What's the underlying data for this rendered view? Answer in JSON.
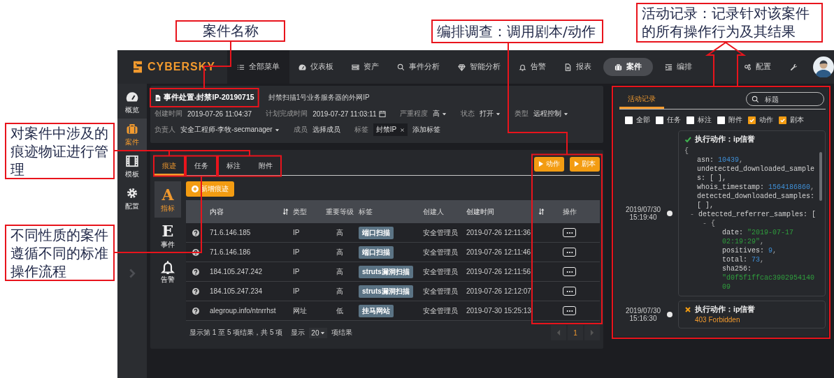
{
  "annotations": [
    {
      "text": "案件名称"
    },
    {
      "text": "编排调查：调用剧本/动作"
    },
    {
      "text": "活动记录：记录针对该案件的所有操作行为及其结果"
    },
    {
      "text": "对案件中涉及的痕迹物证进行管理"
    },
    {
      "text": "不同性质的案件遵循不同的标准操作流程"
    }
  ],
  "logo": "CYBERSKY",
  "nav": {
    "items": [
      {
        "label": "全部菜单",
        "kind": "menu",
        "selected": false
      },
      {
        "label": "仪表板",
        "kind": "page",
        "selected": false
      },
      {
        "label": "资产",
        "kind": "page",
        "selected": false
      },
      {
        "label": "事件分析",
        "kind": "page",
        "selected": false
      },
      {
        "label": "智能分析",
        "kind": "page",
        "selected": false
      },
      {
        "label": "告警",
        "kind": "page",
        "selected": false
      },
      {
        "label": "报表",
        "kind": "page",
        "selected": false
      },
      {
        "label": "案件",
        "kind": "page",
        "selected": true
      },
      {
        "label": "编排",
        "kind": "page",
        "selected": false
      }
    ],
    "settings": "配置"
  },
  "sidebar": {
    "items": [
      {
        "label": "概览",
        "selected": false
      },
      {
        "label": "案件",
        "selected": true
      },
      {
        "label": "模板",
        "selected": false
      },
      {
        "label": "配置",
        "selected": false
      }
    ]
  },
  "case": {
    "title": "事件处置-封禁IP-20190715",
    "description": "封禁扫描1号业务服务器的外网IP",
    "fields": [
      {
        "label": "创建时间",
        "value": "2019-07-26 11:04:37",
        "kind": "text"
      },
      {
        "label": "计划完成时间",
        "value": "2019-07-27 11:03:11",
        "kind": "date"
      },
      {
        "label": "严重程度",
        "value": "高",
        "kind": "select"
      },
      {
        "label": "状态",
        "value": "打开",
        "kind": "select"
      },
      {
        "label": "类型",
        "value": "远程控制",
        "kind": "select"
      }
    ],
    "fields_2": [
      {
        "label": "负责人",
        "value": "安全工程师-李牧-secmanager",
        "kind": "select"
      },
      {
        "label": "成员",
        "value": "选择成员",
        "kind": "text"
      }
    ],
    "tags": {
      "label": "标签",
      "items": [
        "封禁IP"
      ],
      "add": "添加标签"
    }
  },
  "tabs": {
    "items": [
      {
        "label": "痕迹",
        "selected": true
      },
      {
        "label": "任务",
        "selected": false
      },
      {
        "label": "标注",
        "selected": false
      },
      {
        "label": "附件",
        "selected": false
      }
    ],
    "buttons": [
      "动作",
      "剧本"
    ]
  },
  "evidence": {
    "categories": [
      {
        "kind": "glyph",
        "glyph": "A",
        "label": "指标",
        "selected": true
      },
      {
        "kind": "glyph",
        "glyph": "E",
        "label": "事件",
        "selected": false
      },
      {
        "kind": "icon",
        "label": "告警",
        "selected": false
      }
    ],
    "add_button": "新增痕迹",
    "columns": [
      {
        "label": "内容",
        "sortable": true
      },
      {
        "label": "类型",
        "sortable": false
      },
      {
        "label": "重要等级",
        "sortable": false
      },
      {
        "label": "标签",
        "sortable": false
      },
      {
        "label": "创建人",
        "sortable": false
      },
      {
        "label": "创建时间",
        "sortable": true
      },
      {
        "label": "操作",
        "sortable": false
      }
    ],
    "rows": [
      {
        "content": "71.6.146.185",
        "type": "IP",
        "level": "高",
        "tag": "端口扫描",
        "creator": "安全管理员",
        "time": "2019-07-26 12:11:36"
      },
      {
        "content": "71.6.146.186",
        "type": "IP",
        "level": "高",
        "tag": "端口扫描",
        "creator": "安全管理员",
        "time": "2019-07-26 12:11:46"
      },
      {
        "content": "184.105.247.242",
        "type": "IP",
        "level": "高",
        "tag": "struts漏洞扫描",
        "creator": "安全管理员",
        "time": "2019-07-26 12:11:56"
      },
      {
        "content": "184.105.247.234",
        "type": "IP",
        "level": "高",
        "tag": "struts漏洞扫描",
        "creator": "安全管理员",
        "time": "2019-07-26 12:12:07"
      },
      {
        "content": "alegroup.info/ntnrrhst",
        "type": "网址",
        "level": "低",
        "tag": "挂马网站",
        "creator": "安全管理员",
        "time": "2019-07-30 15:25:13"
      }
    ],
    "footer": {
      "summary": "显示第 1 至 5 项结果，共 5 项",
      "show": "显示",
      "page_size": "20",
      "suffix": "项结果",
      "pages": [
        {
          "label": "1",
          "selected": true
        }
      ]
    }
  },
  "activity": {
    "tabs": [
      {
        "label": "活动记录",
        "selected": true
      }
    ],
    "search": {
      "placeholder": "标题"
    },
    "filters": [
      {
        "label": "全部",
        "checked": false
      },
      {
        "label": "任务",
        "checked": false
      },
      {
        "label": "标注",
        "checked": false
      },
      {
        "label": "附件",
        "checked": false
      },
      {
        "label": "动作",
        "checked": true
      },
      {
        "label": "剧本",
        "checked": true
      }
    ],
    "entries": [
      {
        "date": "2019/07/30",
        "time": "15:19:40",
        "succeeded": true,
        "title": "执行动作：ip信誉",
        "code": [
          {
            "parts": [
              {
                "text": "{",
                "kind": "punct"
              }
            ],
            "children": [
              {
                "parts": [
                  {
                    "text": "asn: ",
                    "kind": "key"
                  },
                  {
                    "text": "10439",
                    "kind": "number"
                  },
                  {
                    "text": ",",
                    "kind": "punct"
                  }
                ]
              },
              {
                "parts": [
                  {
                    "text": "undetected_downloaded_samples: [ ],",
                    "kind": "key"
                  }
                ]
              },
              {
                "parts": [
                  {
                    "text": "whois_timestamp: ",
                    "kind": "key"
                  },
                  {
                    "text": "1564186860",
                    "kind": "number"
                  },
                  {
                    "text": ",",
                    "kind": "punct"
                  }
                ]
              },
              {
                "parts": [
                  {
                    "text": "detected_downloaded_samples: [ ],",
                    "kind": "key"
                  }
                ]
              },
              {
                "parts": [
                  {
                    "text": "- ",
                    "kind": "toggle"
                  },
                  {
                    "text": "detected_referrer_samples: [",
                    "kind": "key"
                  }
                ],
                "children": [
                  {
                    "parts": [
                      {
                        "text": "- ",
                        "kind": "toggle"
                      },
                      {
                        "text": "{",
                        "kind": "punct"
                      }
                    ],
                    "children": [
                      {
                        "parts": [
                          {
                            "text": "date: ",
                            "kind": "key"
                          },
                          {
                            "text": "\"2019-07-17 02:19:29\"",
                            "kind": "string"
                          },
                          {
                            "text": ",",
                            "kind": "punct"
                          }
                        ]
                      },
                      {
                        "parts": [
                          {
                            "text": "positives: ",
                            "kind": "key"
                          },
                          {
                            "text": "9",
                            "kind": "number"
                          },
                          {
                            "text": ",",
                            "kind": "punct"
                          }
                        ]
                      },
                      {
                        "parts": [
                          {
                            "text": "total: ",
                            "kind": "key"
                          },
                          {
                            "text": "73",
                            "kind": "number"
                          },
                          {
                            "text": ",",
                            "kind": "punct"
                          }
                        ]
                      },
                      {
                        "parts": [
                          {
                            "text": "sha256: ",
                            "kind": "key"
                          },
                          {
                            "text": "\"d0f5f1ffcac390295414009",
                            "kind": "string"
                          }
                        ]
                      }
                    ]
                  }
                ]
              }
            ]
          }
        ]
      },
      {
        "date": "2019/07/30",
        "time": "15:16:30",
        "succeeded": false,
        "title": "执行动作：ip信誉",
        "result": "403 Forbidden"
      }
    ]
  }
}
